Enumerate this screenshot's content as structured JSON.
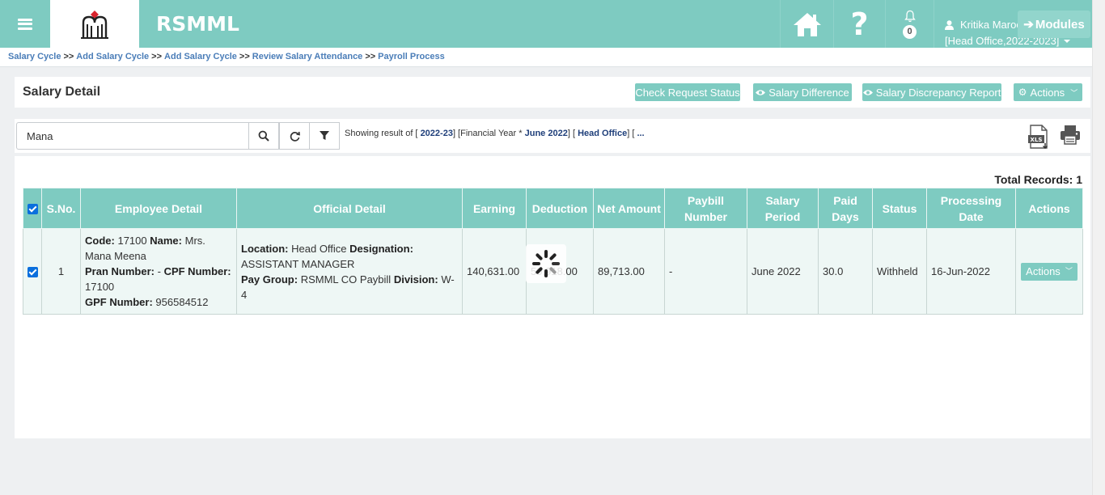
{
  "app": {
    "brand": "RSMML",
    "notifications_count": "0",
    "user_name": "Kritika Maroo",
    "user_context": "[Head Office,2022-2023]",
    "modules_label": "Modules"
  },
  "breadcrumb": {
    "items": [
      "Salary Cycle",
      "Add Salary Cycle",
      "Add Salary Cycle",
      "Review Salary Attendance",
      "Payroll Process"
    ],
    "separator": ">>"
  },
  "page": {
    "title": "Salary Detail",
    "buttons": {
      "check_request_status": "Check Request Status",
      "salary_difference": "Salary Difference",
      "salary_discrepancy_report": "Salary Discrepancy Report",
      "actions": "Actions"
    }
  },
  "search": {
    "value": "Mana",
    "showing_prefix": "Showing result of [",
    "year": "2022-23",
    "mid1": "] [Financial Year *",
    "month": "June 2022",
    "mid2": "] [",
    "office": "Head Office",
    "suffix": "] [",
    "ellipsis": "..."
  },
  "table": {
    "total_records_label": "Total Records: 1",
    "headers": {
      "sno": "S.No.",
      "employee_detail": "Employee Detail",
      "official_detail": "Official Detail",
      "earning": "Earning",
      "deduction": "Deduction",
      "net_amount": "Net Amount",
      "paybill_number": "Paybill Number",
      "salary_period": "Salary Period",
      "paid_days": "Paid Days",
      "status": "Status",
      "processing_date": "Processing Date",
      "actions": "Actions"
    },
    "rows": [
      {
        "sno": "1",
        "code_label": "Code:",
        "code": "17100",
        "name_label": "Name:",
        "name": "Mrs. Mana Meena",
        "pran_label": "Pran Number:",
        "pran": "-",
        "cpf_label": "CPF Number:",
        "cpf": "17100",
        "gpf_label": "GPF Number:",
        "gpf": "956584512",
        "location_label": "Location:",
        "location": "Head Office",
        "designation_label": "Designation:",
        "designation": "ASSISTANT MANAGER",
        "paygroup_label": "Pay Group:",
        "paygroup": "RSMML CO Paybill",
        "division_label": "Division:",
        "division": "W-4",
        "earning": "140,631.00",
        "deduction": "50,918.00",
        "net_amount": "89,713.00",
        "paybill_number": "-",
        "salary_period": "June 2022",
        "paid_days": "30.0",
        "status": "Withheld",
        "processing_date": "16-Jun-2022",
        "actions": "Actions"
      }
    ]
  },
  "colors": {
    "accent": "#7ecbc1",
    "link": "#4a7db8",
    "checkbox": "#0a6fdd"
  }
}
